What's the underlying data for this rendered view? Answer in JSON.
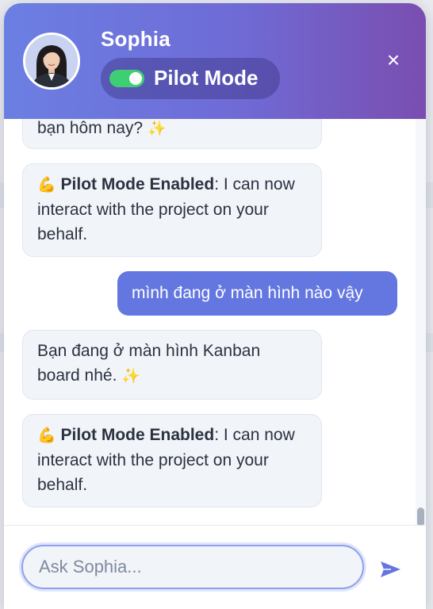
{
  "header": {
    "agent_name": "Sophia",
    "pilot_label": "Pilot Mode",
    "pilot_enabled": true,
    "close_glyph": "×"
  },
  "messages": [
    {
      "role": "bot",
      "text": "bạn hôm nay?",
      "emoji": "✨"
    },
    {
      "role": "bot",
      "emoji": "💪",
      "bold": "Pilot Mode Enabled",
      "text": ": I can now interact with the project on your behalf."
    },
    {
      "role": "user",
      "text": "mình đang ở màn hình nào vậy"
    },
    {
      "role": "bot",
      "text": "Bạn đang ở màn hình Kanban board nhé.",
      "emoji": "✨"
    },
    {
      "role": "bot",
      "emoji": "💪",
      "bold": "Pilot Mode Enabled",
      "text": ": I can now interact with the project on your behalf."
    }
  ],
  "input": {
    "placeholder": "Ask Sophia...",
    "value": ""
  },
  "icons": {
    "send": "send-icon",
    "close": "close-icon",
    "toggle": "toggle-icon"
  },
  "colors": {
    "header_gradient_start": "#6b7fe3",
    "header_gradient_end": "#7a4eb0",
    "toggle_on": "#3ecf73",
    "user_bubble": "#6476e0",
    "bot_bubble": "#f1f4f9",
    "send_icon": "#6476e0"
  }
}
